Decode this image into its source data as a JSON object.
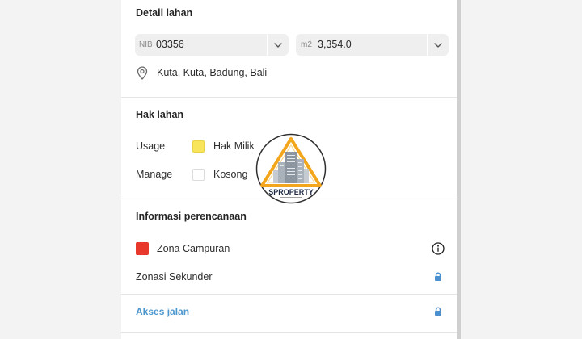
{
  "detail_lahan": {
    "title": "Detail lahan",
    "nib_field": {
      "prefix": "NIB",
      "value": "03356",
      "icon": "chevron-down-icon"
    },
    "area_field": {
      "prefix": "m2",
      "value": "3,354.0",
      "icon": "chevron-down-icon"
    },
    "location": {
      "icon": "map-pin-icon",
      "text": "Kuta, Kuta, Badung, Bali"
    }
  },
  "hak_lahan": {
    "title": "Hak lahan",
    "rows": [
      {
        "label": "Usage",
        "value": "Hak Milik",
        "swatch_color": "#f9e55c",
        "swatch_border": "#e8d24a"
      },
      {
        "label": "Manage",
        "value": "Kosong",
        "swatch_color": "#ffffff",
        "swatch_border": "#dcdcdc"
      }
    ]
  },
  "informasi_perencanaan": {
    "title": "Informasi perencanaan",
    "zona": {
      "label": "Zona Campuran",
      "swatch_color": "#e8382b",
      "icon": "info-icon"
    },
    "zonasi_sekunder": {
      "label": "Zonasi Sekunder",
      "icon": "lock-icon"
    }
  },
  "akses_jalan": {
    "label": "Akses jalan",
    "icon": "lock-icon"
  },
  "colors": {
    "accent": "#4a96cf",
    "lock": "#4a8fd0"
  },
  "watermark": {
    "icon": "watermark-logo-icon",
    "text": "SPROPERTY"
  }
}
